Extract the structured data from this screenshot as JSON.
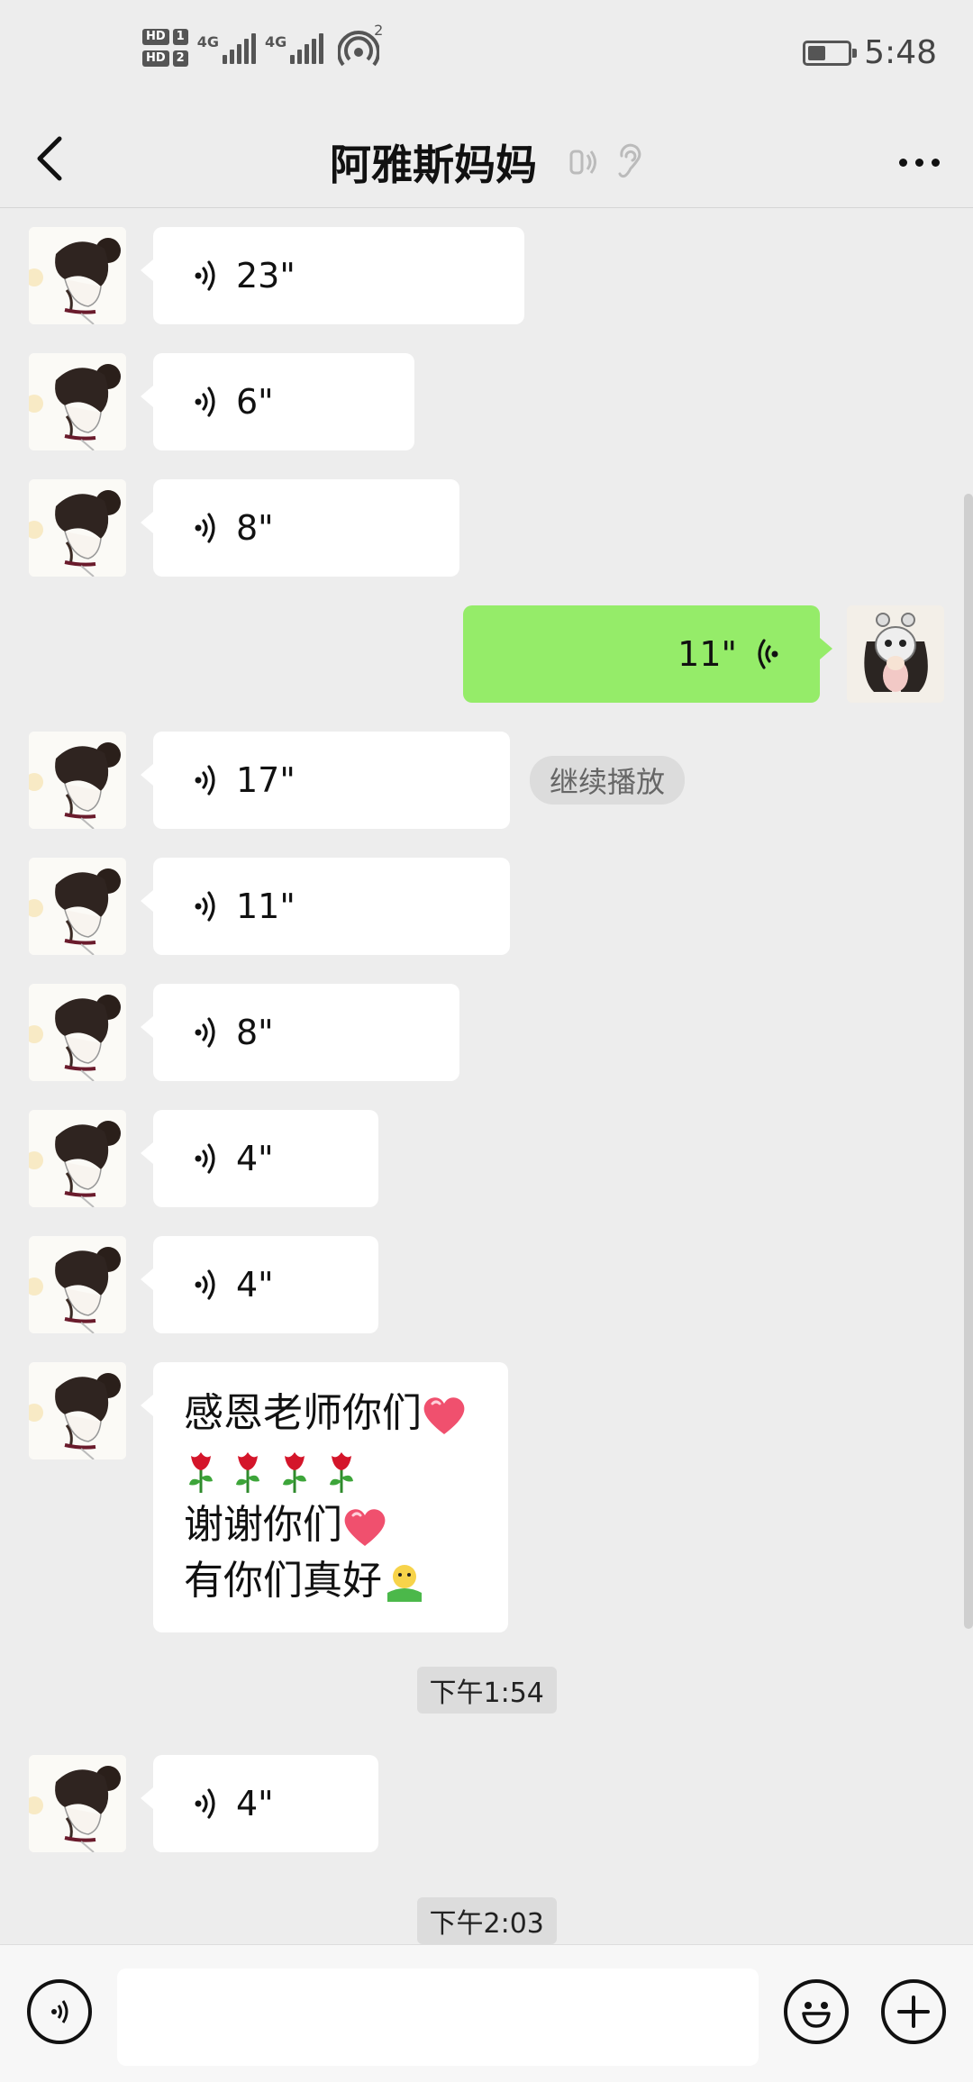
{
  "status_bar": {
    "sim1": "HD",
    "sim1_num": "1",
    "sim2": "HD",
    "sim2_num": "2",
    "network1": "4G",
    "network2": "4G",
    "hotspot_count": "2",
    "time": "5:48",
    "battery_level": 0.45
  },
  "header": {
    "title": "阿雅斯妈妈",
    "icons": [
      "earpiece-icon",
      "ear-icon"
    ]
  },
  "messages": [
    {
      "side": "left",
      "type": "voice",
      "duration": "23\""
    },
    {
      "side": "left",
      "type": "voice",
      "duration": "6\""
    },
    {
      "side": "left",
      "type": "voice",
      "duration": "8\""
    },
    {
      "side": "right",
      "type": "voice",
      "duration": "11\""
    },
    {
      "side": "left",
      "type": "voice",
      "duration": "17\"",
      "continue_label": "继续播放"
    },
    {
      "side": "left",
      "type": "voice",
      "duration": "11\""
    },
    {
      "side": "left",
      "type": "voice",
      "duration": "8\""
    },
    {
      "side": "left",
      "type": "voice",
      "duration": "4\""
    },
    {
      "side": "left",
      "type": "voice",
      "duration": "4\""
    },
    {
      "side": "left",
      "type": "text",
      "lines": [
        "感恩老师你们",
        "",
        "谢谢你们",
        "有你们真好"
      ]
    },
    {
      "type": "timestamp",
      "text": "下午1:54"
    },
    {
      "side": "left",
      "type": "voice",
      "duration": "4\""
    },
    {
      "type": "timestamp",
      "text": "下午2:03"
    }
  ],
  "colors": {
    "background": "#ededed",
    "own_bubble": "#95ec69",
    "other_bubble": "#ffffff"
  },
  "bottom_bar": {
    "icons": [
      "voice-input-icon",
      "emoji-icon",
      "plus-icon"
    ]
  }
}
